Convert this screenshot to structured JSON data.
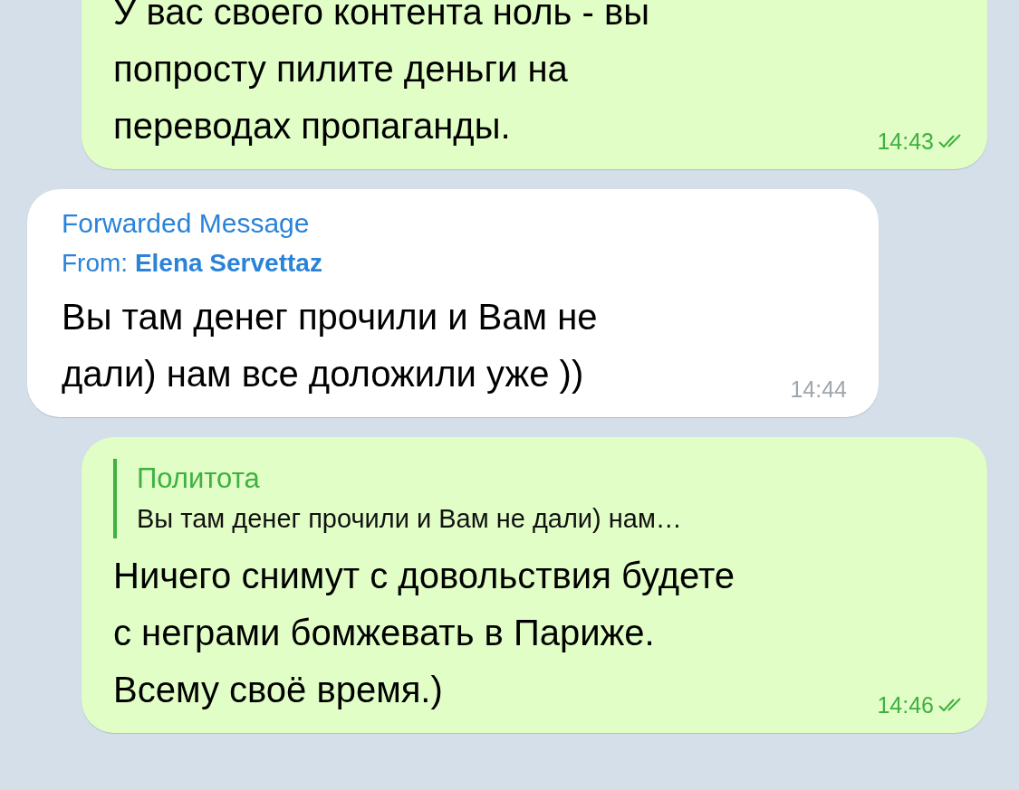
{
  "messages": [
    {
      "kind": "outgoing",
      "text": "У вас своего контента ноль - вы\nпопросту пилите деньги на\nпереводах пропаганды.",
      "time": "14:43",
      "read": true
    },
    {
      "kind": "incoming",
      "forwarded": {
        "title": "Forwarded Message",
        "from": "From: **Elena Servettaz**"
      },
      "text": "Вы там денег прочили и Вам не\nдали) нам все доложили уже ))",
      "time": "14:44"
    },
    {
      "kind": "outgoing",
      "reply": {
        "name": "Политота",
        "text": "Вы там денег прочили и Вам не дали) нам…"
      },
      "text": "Ничего снимут с довольствия будете\nс неграми бомжевать в Париже.\nВсему своё время.)",
      "time": "14:46",
      "read": true
    }
  ]
}
